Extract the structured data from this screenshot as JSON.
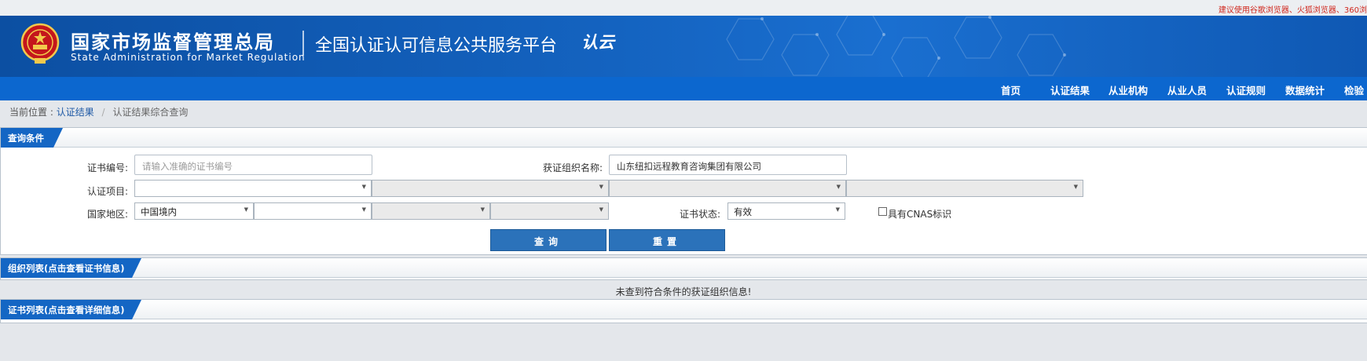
{
  "top_note": "建议使用谷歌浏览器、火狐浏览器、360浏",
  "header": {
    "org_name_cn": "国家市场监督管理总局",
    "org_name_en": "State Administration  for  Market Regulation",
    "platform_name": "全国认证认可信息公共服务平台",
    "logo_text": "认云"
  },
  "nav": [
    "首页",
    "认证结果",
    "从业机构",
    "从业人员",
    "认证规则",
    "数据统计",
    "检验"
  ],
  "breadcrumb": {
    "prefix": "当前位置 :",
    "link": "认证结果",
    "separator": "/",
    "current": "认证结果综合查询"
  },
  "query_panel": {
    "title": "查询条件",
    "cert_no_label": "证书编号:",
    "cert_no_placeholder": "请输入准确的证书编号",
    "org_name_label": "获证组织名称:",
    "org_name_value": "山东纽扣远程教育咨询集团有限公司",
    "project_label": "认证项目:",
    "region_label": "国家地区:",
    "region_value": "中国境内",
    "status_label": "证书状态:",
    "status_value": "有效",
    "cnas_label": "具有CNAS标识",
    "query_button": "查询",
    "reset_button": "重置"
  },
  "org_panel": {
    "title": "组织列表(点击查看证书信息)",
    "empty_message": "未查到符合条件的获证组织信息!"
  },
  "cert_panel": {
    "title": "证书列表(点击查看详细信息)"
  },
  "colors": {
    "header_blue": "#0c4fa2",
    "nav_blue": "#0c67cf",
    "tab_blue": "#1466c4",
    "button_blue": "#2b72ba",
    "note_red": "#d0271d"
  }
}
